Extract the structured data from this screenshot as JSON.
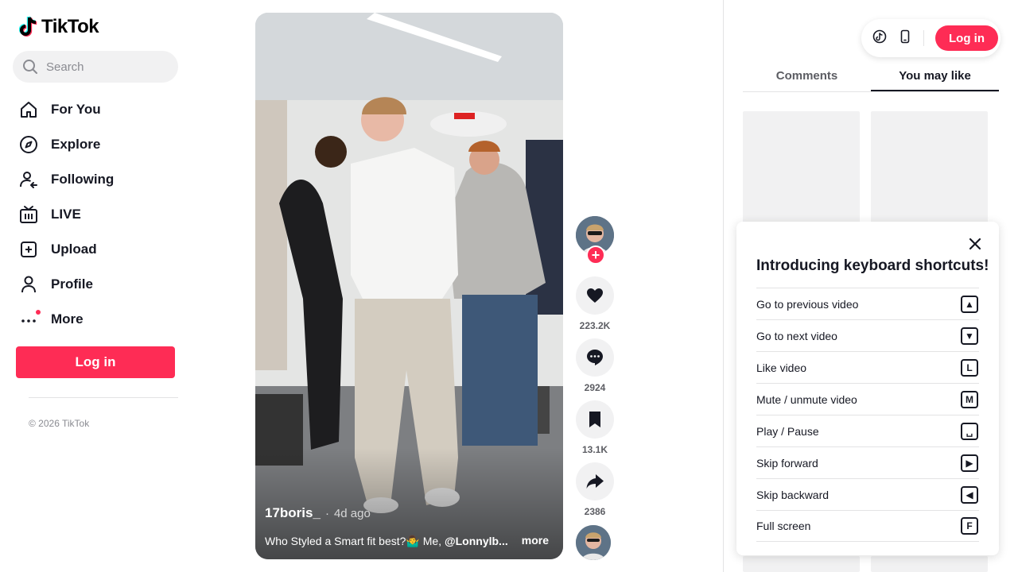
{
  "app": {
    "name": "TikTok"
  },
  "brand": {
    "accent": "#fe2c55",
    "text": "#161823",
    "muted": "#8a8b91"
  },
  "search": {
    "placeholder": "Search",
    "icon": "search-icon"
  },
  "sidebar": {
    "items": [
      {
        "label": "For You",
        "icon": "home-icon"
      },
      {
        "label": "Explore",
        "icon": "compass-icon"
      },
      {
        "label": "Following",
        "icon": "following-icon"
      },
      {
        "label": "LIVE",
        "icon": "live-tv-icon"
      },
      {
        "label": "Upload",
        "icon": "upload-plus-icon"
      },
      {
        "label": "Profile",
        "icon": "profile-icon"
      },
      {
        "label": "More",
        "icon": "more-dots-icon",
        "has_notification_dot": true
      }
    ],
    "login_label": "Log in",
    "copyright": "© 2026 TikTok"
  },
  "video": {
    "author": "17boris_",
    "separator": "·",
    "posted": "4d ago",
    "caption_text": "Who Styled a Smart fit best?🤷‍♂️ Me, ",
    "caption_mention": "@Lonnylb...",
    "more_label": "more"
  },
  "actions": {
    "follow_label": "+",
    "likes": "223.2K",
    "comments": "2924",
    "saves": "13.1K",
    "shares": "2386"
  },
  "topbar": {
    "login_label": "Log in",
    "icons": [
      "tiktok-coin-icon",
      "mobile-device-icon"
    ]
  },
  "tabs": [
    {
      "label": "Comments",
      "active": false
    },
    {
      "label": "You may like",
      "active": true
    }
  ],
  "shortcuts": {
    "title": "Introducing keyboard shortcuts!",
    "items": [
      {
        "label": "Go to previous video",
        "key": "▲",
        "key_icon": "arrow-up-key-icon"
      },
      {
        "label": "Go to next video",
        "key": "▼",
        "key_icon": "arrow-down-key-icon"
      },
      {
        "label": "Like video",
        "key": "L",
        "key_icon": "l-key-icon"
      },
      {
        "label": "Mute / unmute video",
        "key": "M",
        "key_icon": "m-key-icon"
      },
      {
        "label": "Play / Pause",
        "key": "␣",
        "key_icon": "space-key-icon"
      },
      {
        "label": "Skip forward",
        "key": "▶",
        "key_icon": "arrow-right-key-icon"
      },
      {
        "label": "Skip backward",
        "key": "◀",
        "key_icon": "arrow-left-key-icon"
      },
      {
        "label": "Full screen",
        "key": "F",
        "key_icon": "f-key-icon"
      }
    ]
  }
}
